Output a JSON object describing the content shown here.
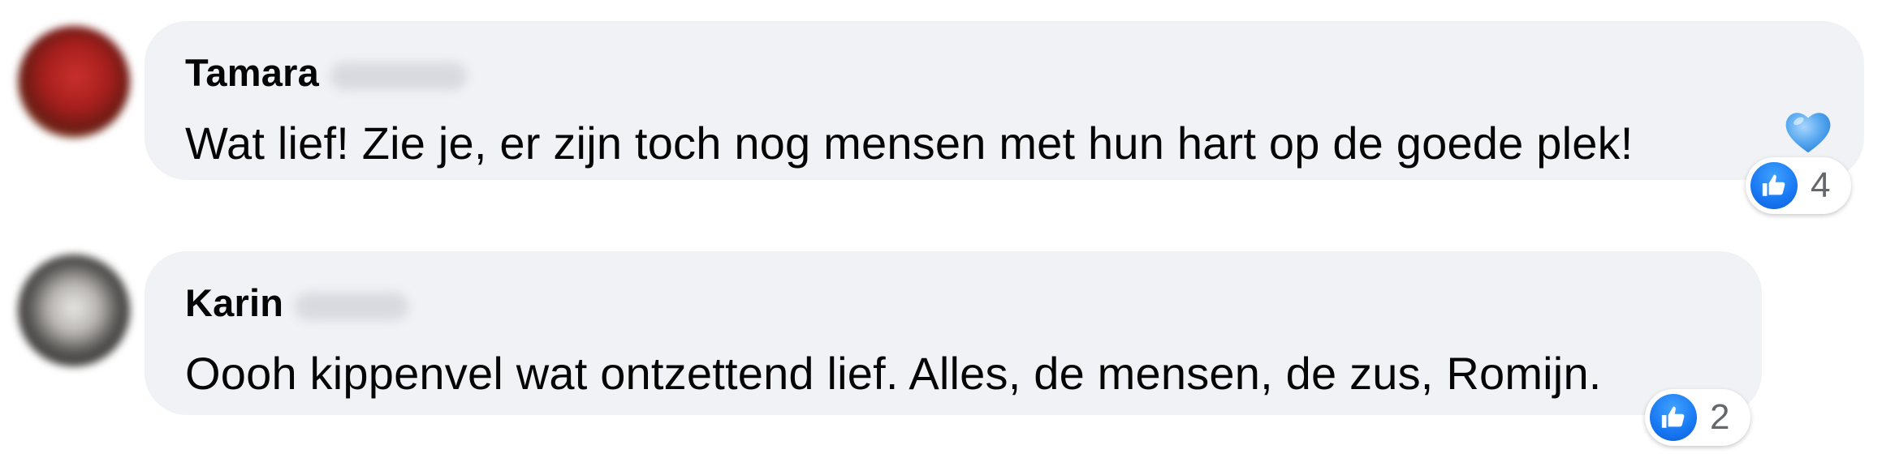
{
  "comments": [
    {
      "author": "Tamara",
      "text": "Wat lief! Zie je, er zijn toch nog mensen met hun hart op de goede plek!",
      "emoji": "blue-heart",
      "reaction_count": "4",
      "reaction_type": "like"
    },
    {
      "author": "Karin",
      "text": "Oooh kippenvel wat ontzettend lief. Alles, de mensen, de zus, Romijn.",
      "reaction_count": "2",
      "reaction_type": "like"
    }
  ],
  "colors": {
    "bubble": "#f0f2f5",
    "like_blue": "#1877f2",
    "heart_blue": "#5aa9f0",
    "text": "#050505",
    "count": "#65676b"
  }
}
